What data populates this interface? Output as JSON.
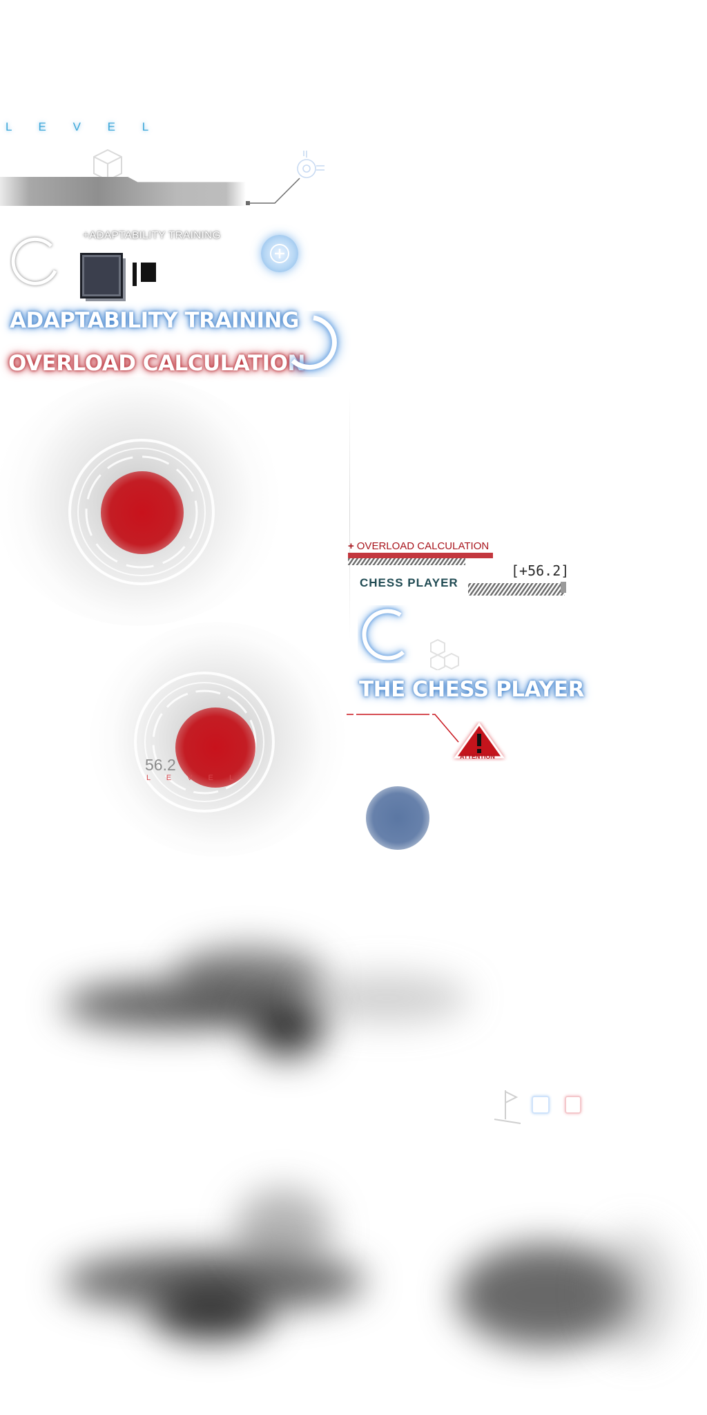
{
  "header": {
    "level_label": "L E V E L"
  },
  "adaptability": {
    "small_label": "ADAPTABILITY TRAINING",
    "small_label_prefix": "+",
    "plus_symbol": "+",
    "title": "ADAPTABILITY TRAINING"
  },
  "overload": {
    "title": "OVERLOAD CALCULATION"
  },
  "orb_secondary": {
    "value": "56.2",
    "label": "L E V E L"
  },
  "chess_panel": {
    "overload_tag_prefix": "+",
    "overload_tag": "OVERLOAD CALCULATION",
    "player_label": "CHESS PLAYER",
    "player_value": "[+56.2]",
    "title": "THE CHESS PLAYER",
    "alert_label": "ATTENTION"
  },
  "colors": {
    "accent_blue": "#3f7fc8",
    "accent_red": "#b52a33",
    "orb_red": "#c41d24",
    "dot_blue": "#5b77a3"
  },
  "icons": [
    "cube-icon",
    "crosshair-icon",
    "plus-icon",
    "bars-icon",
    "cube-stack-icon",
    "warning-icon",
    "flag-icon"
  ]
}
